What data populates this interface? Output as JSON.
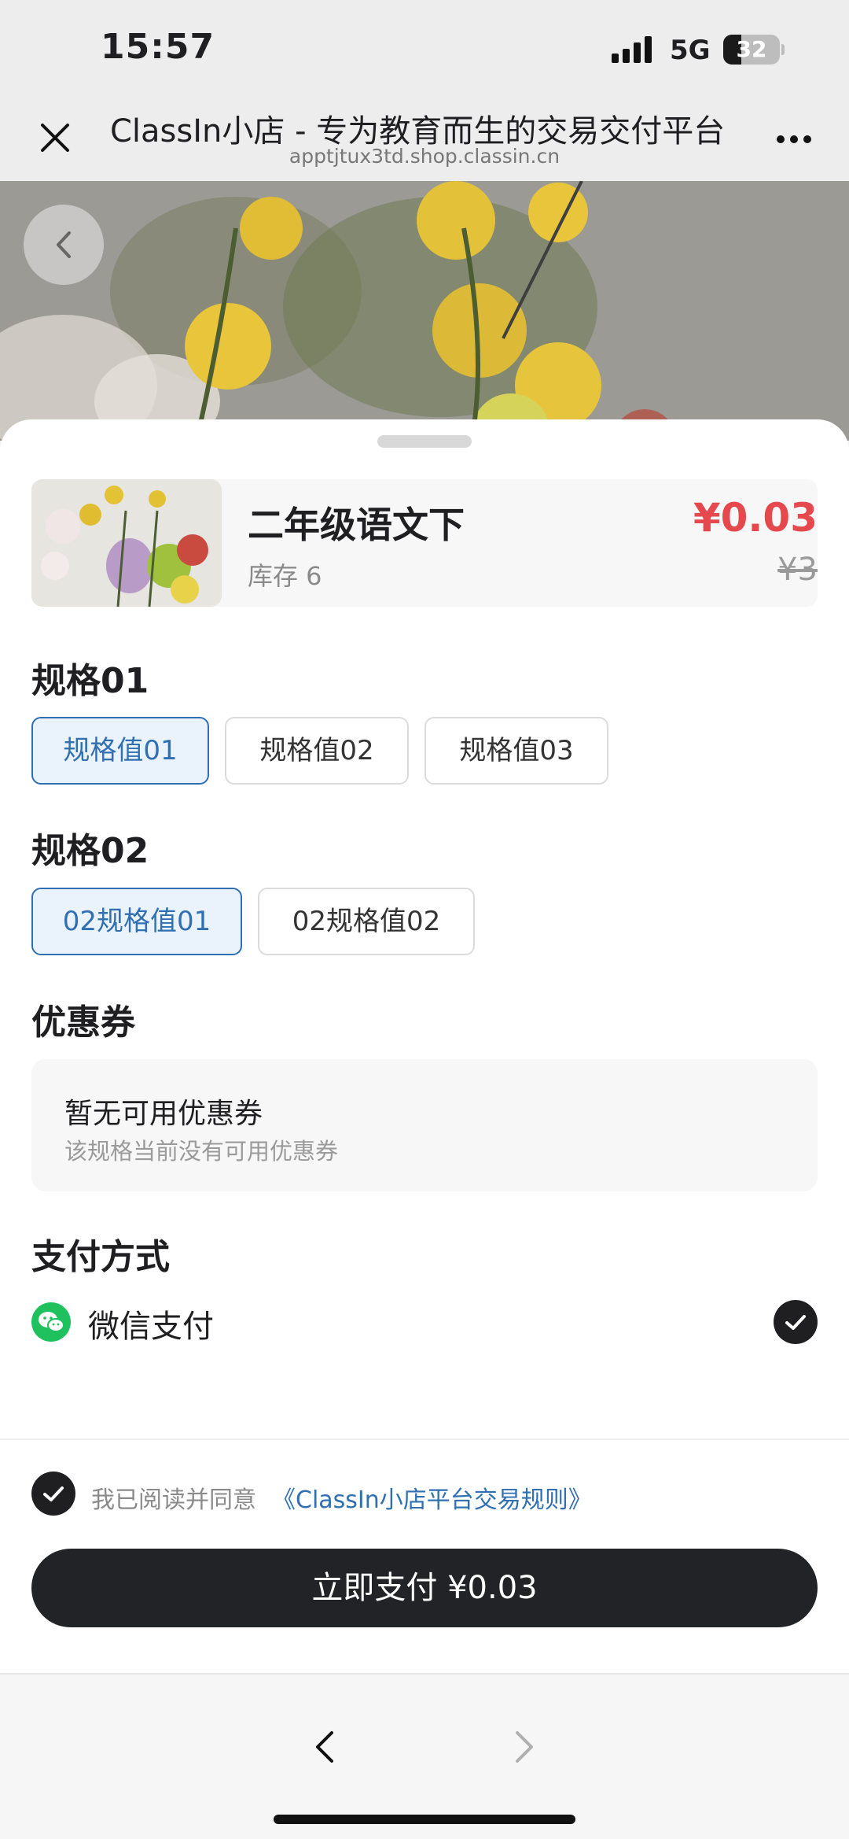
{
  "status_bar": {
    "time": "15:57",
    "network": "5G",
    "battery": "32",
    "battery_level": 0.32
  },
  "nav": {
    "title": "ClassIn小店 - 专为教育而生的交易交付平台",
    "url": "apptjtux3td.shop.classin.cn"
  },
  "product": {
    "name": "二年级语文下",
    "stock": "库存 6",
    "price": "¥0.03",
    "original_price": "¥3"
  },
  "spec1": {
    "title": "规格01",
    "options": [
      "规格值01",
      "规格值02",
      "规格值03"
    ],
    "selected": "规格值01"
  },
  "spec2": {
    "title": "规格02",
    "options": [
      "02规格值01",
      "02规格值02"
    ],
    "selected": "02规格值01"
  },
  "coupon": {
    "title": "优惠券",
    "main_text": "暂无可用优惠券",
    "sub_text": "该规格当前没有可用优惠券"
  },
  "payment": {
    "title": "支付方式",
    "method": "微信支付",
    "selected": true
  },
  "agreement": {
    "text": "我已阅读并同意",
    "link": "《ClassIn小店平台交易规则》",
    "checked": true
  },
  "pay_button": {
    "label": "立即支付 ¥0.03"
  },
  "colors": {
    "accent_blue": "#2f6fb2",
    "price_red": "#e5484d",
    "wechat_green": "#1fc15e",
    "dark": "#222326"
  }
}
